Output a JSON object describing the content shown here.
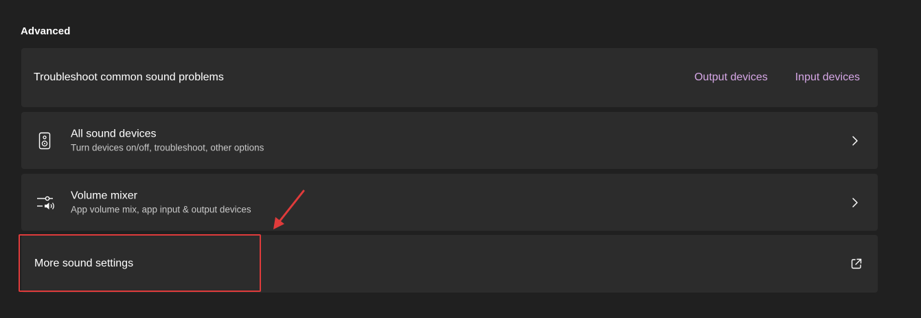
{
  "section": {
    "title": "Advanced"
  },
  "troubleshoot": {
    "label": "Troubleshoot common sound problems",
    "links": [
      "Output devices",
      "Input devices"
    ]
  },
  "all_sound_devices": {
    "icon": "speaker-icon",
    "title": "All sound devices",
    "subtitle": "Turn devices on/off, troubleshoot, other options"
  },
  "volume_mixer": {
    "icon": "volume-mixer-icon",
    "title": "Volume mixer",
    "subtitle": "App volume mix, app input & output devices"
  },
  "more_sound_settings": {
    "label": "More sound settings",
    "icon": "external-link-icon"
  },
  "annotation": {
    "color": "#e03b3b"
  },
  "colors": {
    "background": "#202020",
    "card": "#2c2c2c",
    "link": "#d6a7e6"
  }
}
